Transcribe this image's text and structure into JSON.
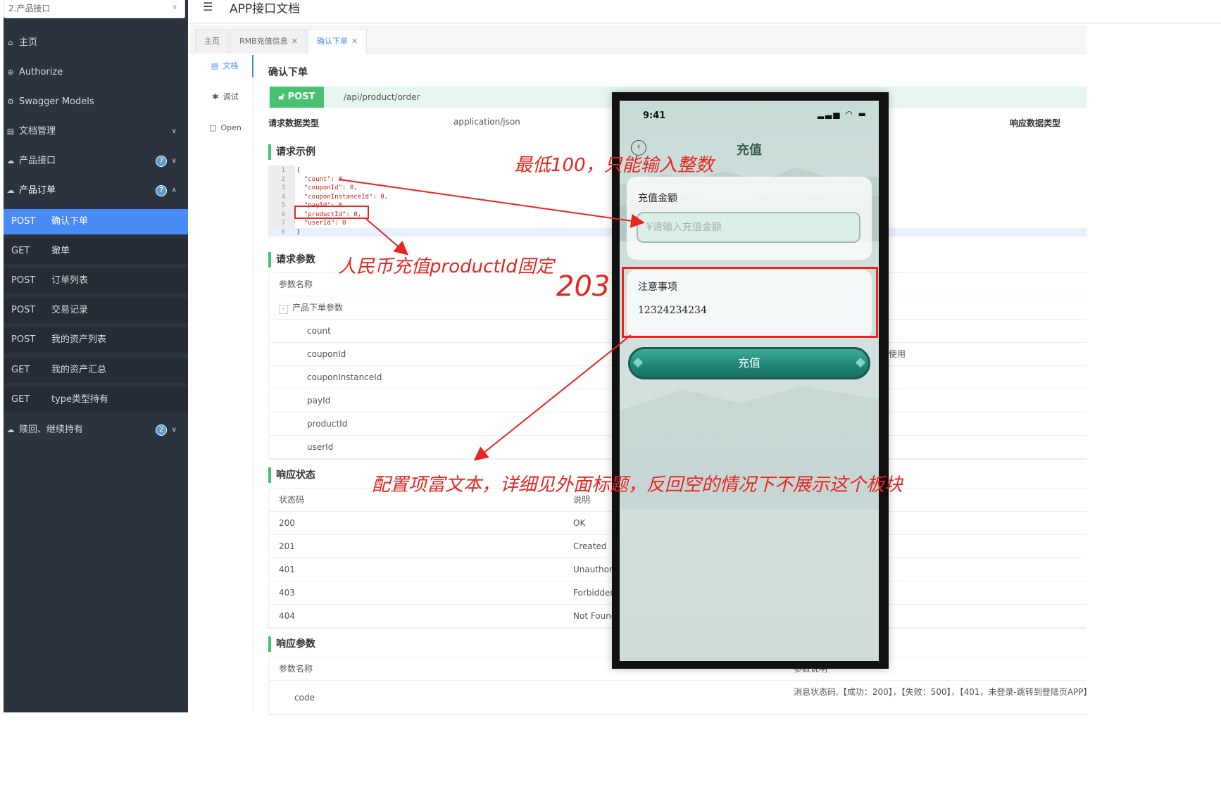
{
  "sidebar": {
    "group_select": "2.产品接口",
    "menu": [
      {
        "label": "主页"
      },
      {
        "label": "Authorize"
      },
      {
        "label": "Swagger Models"
      },
      {
        "label": "文档管理"
      },
      {
        "label": "产品接口",
        "badge": "7"
      },
      {
        "label": "产品订单",
        "badge": "7"
      },
      {
        "label": "赎回、继续持有",
        "badge": "2"
      }
    ],
    "apis": [
      {
        "method": "POST",
        "name": "确认下单"
      },
      {
        "method": "GET",
        "name": "撤单"
      },
      {
        "method": "POST",
        "name": "订单列表"
      },
      {
        "method": "POST",
        "name": "交易记录"
      },
      {
        "method": "POST",
        "name": "我的资产列表"
      },
      {
        "method": "GET",
        "name": "我的资产汇总"
      },
      {
        "method": "GET",
        "name": "type类型持有"
      }
    ]
  },
  "header": {
    "title": "APP接口文档"
  },
  "tabs": [
    {
      "label": "主页"
    },
    {
      "label": "RMB充值信息"
    },
    {
      "label": "确认下单"
    }
  ],
  "doc_nav": [
    {
      "label": "文档"
    },
    {
      "label": "调试"
    },
    {
      "label": "Open"
    }
  ],
  "doc": {
    "title": "确认下单",
    "method": "POST",
    "url": "/api/product/order",
    "request_type_label": "请求数据类型",
    "request_type": "application/json",
    "response_type_label": "响应数据类型",
    "example_title": "请求示例",
    "code": [
      {
        "n": "1",
        "t": "{"
      },
      {
        "n": "2",
        "t": "  \"count\": 0,"
      },
      {
        "n": "3",
        "t": "  \"couponId\": 0,"
      },
      {
        "n": "4",
        "t": "  \"couponInstanceId\": 0,"
      },
      {
        "n": "5",
        "t": "  \"payId\": 0,"
      },
      {
        "n": "6",
        "t": "  \"productId\": 0,"
      },
      {
        "n": "7",
        "t": "  \"userId\": 0"
      },
      {
        "n": "8",
        "t": "}"
      }
    ],
    "params_title": "请求参数",
    "params_header": "参数名称",
    "params_group": "产品下单参数",
    "params": [
      "count",
      "couponId",
      "couponInstanceId",
      "payId",
      "productId",
      "userId"
    ],
    "coupon_note": "使用",
    "status_title": "响应状态",
    "status_header": {
      "code": "状态码",
      "desc": "说明"
    },
    "statuses": [
      {
        "code": "200",
        "desc": "OK"
      },
      {
        "code": "201",
        "desc": "Created"
      },
      {
        "code": "401",
        "desc": "Unauthori"
      },
      {
        "code": "403",
        "desc": "Forbidden"
      },
      {
        "code": "404",
        "desc": "Not Found"
      }
    ],
    "resp_title": "响应参数",
    "resp_header": {
      "name": "参数名称",
      "desc": "参数说明"
    },
    "resp_rows": [
      {
        "name": "code",
        "desc": "消息状态码,【成功：200】，【失败：500】，【401，未登录-跳转到登陆页APP】"
      }
    ]
  },
  "phone": {
    "time": "9:41",
    "title": "充值",
    "amount_label": "充值金额",
    "amount_placeholder": "¥请输入充值金额",
    "notice_label": "注意事项",
    "notice_text": "12324234234",
    "button": "充值"
  },
  "annotations": {
    "min_note": "最低100，只能输入整数",
    "product_note": "人民币充值productId固定",
    "product_value": "203",
    "rich_note": "配置项富文本，详细见外面标题，反回空的情况下不展示这个板块"
  },
  "colors": {
    "sidebar_bg": "#2b333e",
    "accent_blue": "#4a8af4",
    "post_green": "#49c173",
    "annotation_red": "#e8251f",
    "phone_button": "#1e8577"
  }
}
